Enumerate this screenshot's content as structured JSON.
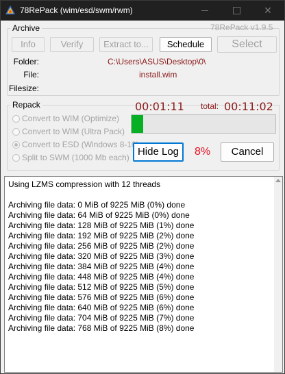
{
  "window": {
    "title": "78RePack (wim/esd/swm/rwm)",
    "version": "78RePack v1.9.5"
  },
  "archive": {
    "group_label": "Archive",
    "buttons": {
      "info": "Info",
      "verify": "Verify",
      "extract": "Extract to...",
      "schedule": "Schedule",
      "select": "Select"
    },
    "folder_label": "Folder:",
    "folder_value": "C:\\Users\\ASUS\\Desktop\\0\\",
    "file_label": "File:",
    "file_value": "install.wim",
    "filesize_label": "Filesize:"
  },
  "repack": {
    "group_label": "Repack",
    "elapsed": "00:01:11",
    "total_label": "total:",
    "total": "00:11:02",
    "options": [
      {
        "label": "Convert to WIM (Optimize)",
        "selected": false
      },
      {
        "label": "Convert to WIM (Ultra Pack)",
        "selected": false
      },
      {
        "label": "Convert to ESD (Windows 8-10)",
        "selected": true
      },
      {
        "label": "Split to SWM (1000 Mb each)",
        "selected": false
      }
    ],
    "progress_fraction": 0.08,
    "hide_log_label": "Hide Log",
    "percent": "8%",
    "cancel_label": "Cancel"
  },
  "log": {
    "lines": [
      "Using LZMS compression with 12 threads",
      "",
      "Archiving file data: 0 MiB of 9225 MiB (0%) done",
      "Archiving file data: 64 MiB of 9225 MiB (0%) done",
      "Archiving file data: 128 MiB of 9225 MiB (1%) done",
      "Archiving file data: 192 MiB of 9225 MiB (2%) done",
      "Archiving file data: 256 MiB of 9225 MiB (2%) done",
      "Archiving file data: 320 MiB of 9225 MiB (3%) done",
      "Archiving file data: 384 MiB of 9225 MiB (4%) done",
      "Archiving file data: 448 MiB of 9225 MiB (4%) done",
      "Archiving file data: 512 MiB of 9225 MiB (5%) done",
      "Archiving file data: 576 MiB of 9225 MiB (6%) done",
      "Archiving file data: 640 MiB of 9225 MiB (6%) done",
      "Archiving file data: 704 MiB of 9225 MiB (7%) done",
      "Archiving file data: 768 MiB of 9225 MiB (8%) done"
    ]
  },
  "colors": {
    "accent_red": "#8b1a1a",
    "percent_red": "#e81123",
    "progress_green": "#06b025",
    "titlebar": "#202020"
  },
  "icons": {
    "app": "78repack-app-icon",
    "minimize": "minimize-icon",
    "maximize": "maximize-icon",
    "close": "close-icon"
  }
}
